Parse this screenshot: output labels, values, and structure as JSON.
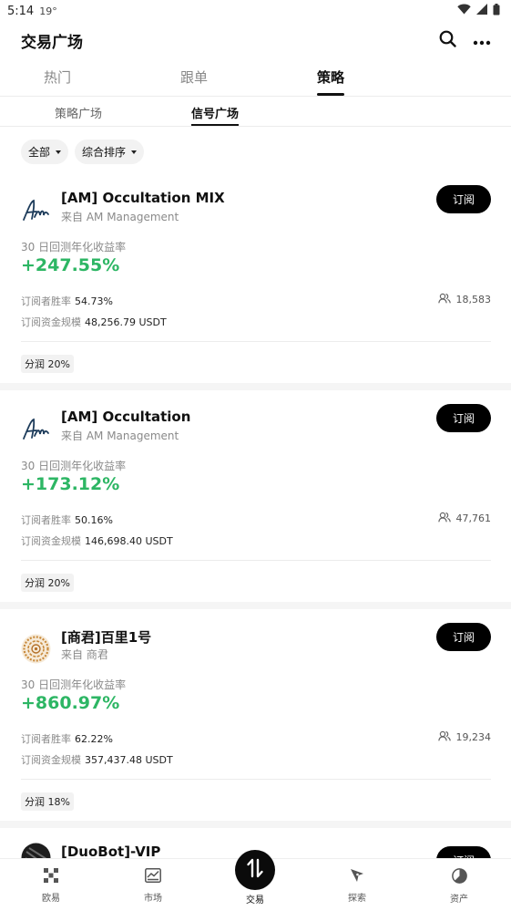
{
  "status_bar": {
    "time": "5:14",
    "temperature": "19°"
  },
  "header": {
    "title": "交易广场"
  },
  "main_tabs": [
    {
      "label": "热门",
      "active": false
    },
    {
      "label": "跟单",
      "active": false
    },
    {
      "label": "策略",
      "active": true
    }
  ],
  "sub_tabs": [
    {
      "label": "策略广场",
      "active": false
    },
    {
      "label": "信号广场",
      "active": true
    }
  ],
  "filters": [
    {
      "label": "全部"
    },
    {
      "label": "综合排序"
    }
  ],
  "cards": [
    {
      "name": "[AM] Occultation MIX",
      "source": "来自 AM Management",
      "logo_icon": "signature-logo-icon",
      "subscribe_label": "订阅",
      "metric_label": "30 日回测年化收益率",
      "metric_value": "+247.55%",
      "win_rate_label": "订阅者胜率",
      "win_rate": "54.73%",
      "fund_label": "订阅资金规模",
      "fund": "48,256.79 USDT",
      "subscribers": "18,583",
      "profit_share": "分润 20%"
    },
    {
      "name": "[AM] Occultation",
      "source": "来自 AM Management",
      "logo_icon": "signature-logo-icon",
      "subscribe_label": "订阅",
      "metric_label": "30 日回测年化收益率",
      "metric_value": "+173.12%",
      "win_rate_label": "订阅者胜率",
      "win_rate": "50.16%",
      "fund_label": "订阅资金规模",
      "fund": "146,698.40 USDT",
      "subscribers": "47,761",
      "profit_share": "分润 20%"
    },
    {
      "name": "[商君]百里1号",
      "source": "来自 商君",
      "logo_icon": "ornament-logo-icon",
      "subscribe_label": "订阅",
      "metric_label": "30 日回测年化收益率",
      "metric_value": "+860.97%",
      "win_rate_label": "订阅者胜率",
      "win_rate": "62.22%",
      "fund_label": "订阅资金规模",
      "fund": "357,437.48 USDT",
      "subscribers": "19,234",
      "profit_share": "分润 18%"
    },
    {
      "name": "[DuoBot]-VIP",
      "subscribe_label": "订阅",
      "logo_icon": "dark-avatar-icon"
    }
  ],
  "bottom_nav": [
    {
      "label": "欧易",
      "icon": "okx-icon"
    },
    {
      "label": "市场",
      "icon": "chart-icon"
    },
    {
      "label": "交易",
      "icon": "trade-icon",
      "active": true
    },
    {
      "label": "探索",
      "icon": "compass-icon"
    },
    {
      "label": "资产",
      "icon": "pie-icon"
    }
  ],
  "colors": {
    "accent_green": "#2db664",
    "primary": "#000000"
  }
}
